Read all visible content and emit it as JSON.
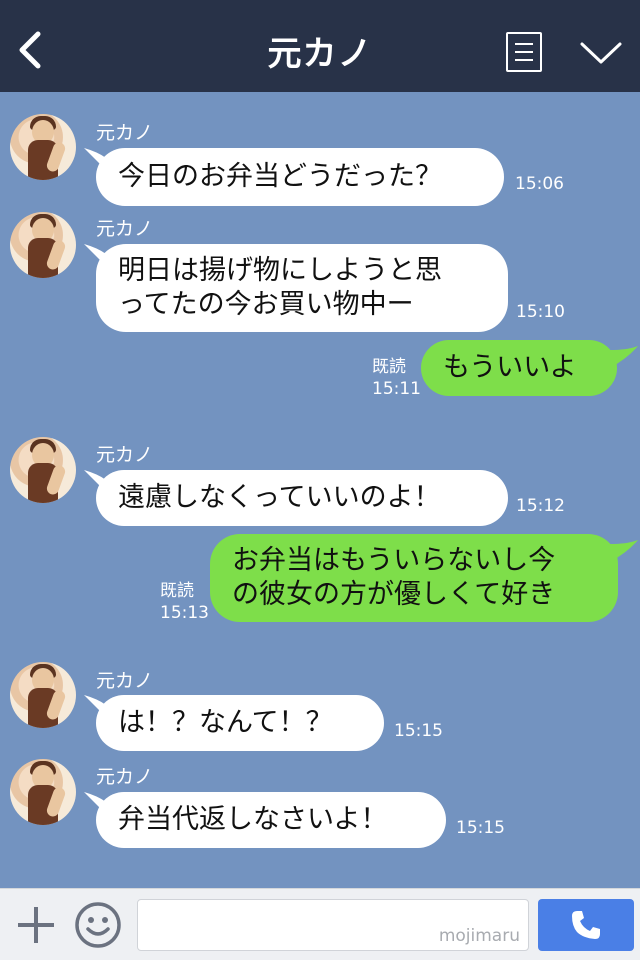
{
  "header": {
    "title": "元カノ",
    "back_icon": "chevron-left-icon",
    "menu_icon": "list-icon",
    "chevron_icon": "chevron-down-icon"
  },
  "messages": [
    {
      "side": "in",
      "sender": "元カノ",
      "text": "今日のお弁当どうだった？",
      "time": "15:06"
    },
    {
      "side": "in",
      "sender": "元カノ",
      "lines": [
        "明日は揚げ物にしようと思",
        "ってたの今お買い物中ー"
      ],
      "time": "15:10"
    },
    {
      "side": "out",
      "read": "既読",
      "text": "もういいよ",
      "time": "15:11"
    },
    {
      "side": "in",
      "sender": "元カノ",
      "text": "遠慮しなくっていいのよ！",
      "time": "15:12"
    },
    {
      "side": "out",
      "read": "既読",
      "lines": [
        "お弁当はもういらないし今",
        "の彼女の方が優しくて好き"
      ],
      "time": "15:13"
    },
    {
      "side": "in",
      "sender": "元カノ",
      "text": "は！？なんて！？",
      "time": "15:15"
    },
    {
      "side": "in",
      "sender": "元カノ",
      "text": "弁当代返しなさいよ！",
      "time": "15:15"
    }
  ],
  "composer": {
    "plus_icon": "plus-icon",
    "emoji_icon": "smile-icon",
    "input_value": "",
    "watermark": "mojimaru",
    "send_icon": "phone-icon"
  },
  "colors": {
    "background": "#7393c0",
    "header": "#283248",
    "incoming_bubble": "#ffffff",
    "outgoing_bubble": "#7ede4a",
    "send_button": "#4a7fe6"
  }
}
